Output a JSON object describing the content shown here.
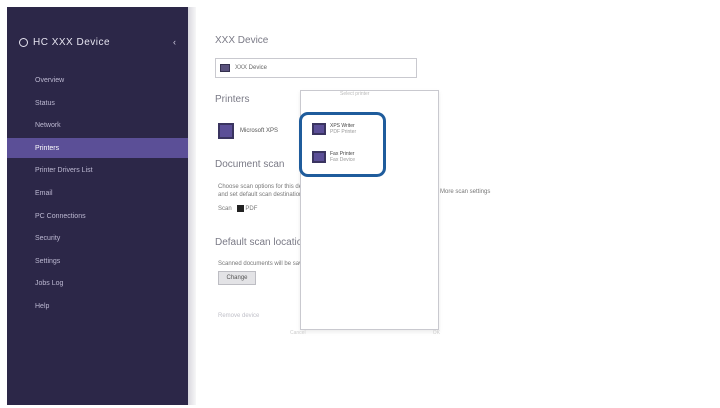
{
  "sidebar": {
    "app_title": "HC XXX Device",
    "collapse_glyph": "‹",
    "items": [
      {
        "label": "Overview",
        "active": false
      },
      {
        "label": "Status",
        "active": false
      },
      {
        "label": "Network",
        "active": false
      },
      {
        "label": "Printers",
        "active": true
      },
      {
        "label": "Printer Drivers List",
        "active": false
      },
      {
        "label": "Email",
        "active": false
      },
      {
        "label": "PC Connections",
        "active": false
      },
      {
        "label": "Security",
        "active": false
      },
      {
        "label": "Settings",
        "active": false
      },
      {
        "label": "Jobs Log",
        "active": false
      },
      {
        "label": "Help",
        "active": false
      }
    ]
  },
  "main": {
    "section1_title": "XXX Device",
    "device_input_value": "XXX Device",
    "section2_title": "Printers",
    "printer_name": "Microsoft XPS",
    "section3_title": "Document scan",
    "scan_text_1": "Choose scan options for this device",
    "scan_text_2": "and set default scan destination",
    "scan_checkbox_label": "Scan",
    "scan_value": "PDF",
    "right_text": "More scan settings",
    "section4_title": "Default scan location",
    "default_location_text": "Scanned documents will be saved to",
    "change_button": "Change",
    "faint_link": "Remove device"
  },
  "popup": {
    "header": "Select printer",
    "devices": [
      {
        "name": "XPS Writer",
        "sub": "PDF Printer"
      },
      {
        "name": "Fax Printer",
        "sub": "Fax Device"
      }
    ],
    "footer_left": "Cancel",
    "footer_right": "OK"
  },
  "colors": {
    "sidebar_bg": "#2c2748",
    "sidebar_active": "#5b4f97",
    "highlight_border": "#1f5c9c"
  }
}
